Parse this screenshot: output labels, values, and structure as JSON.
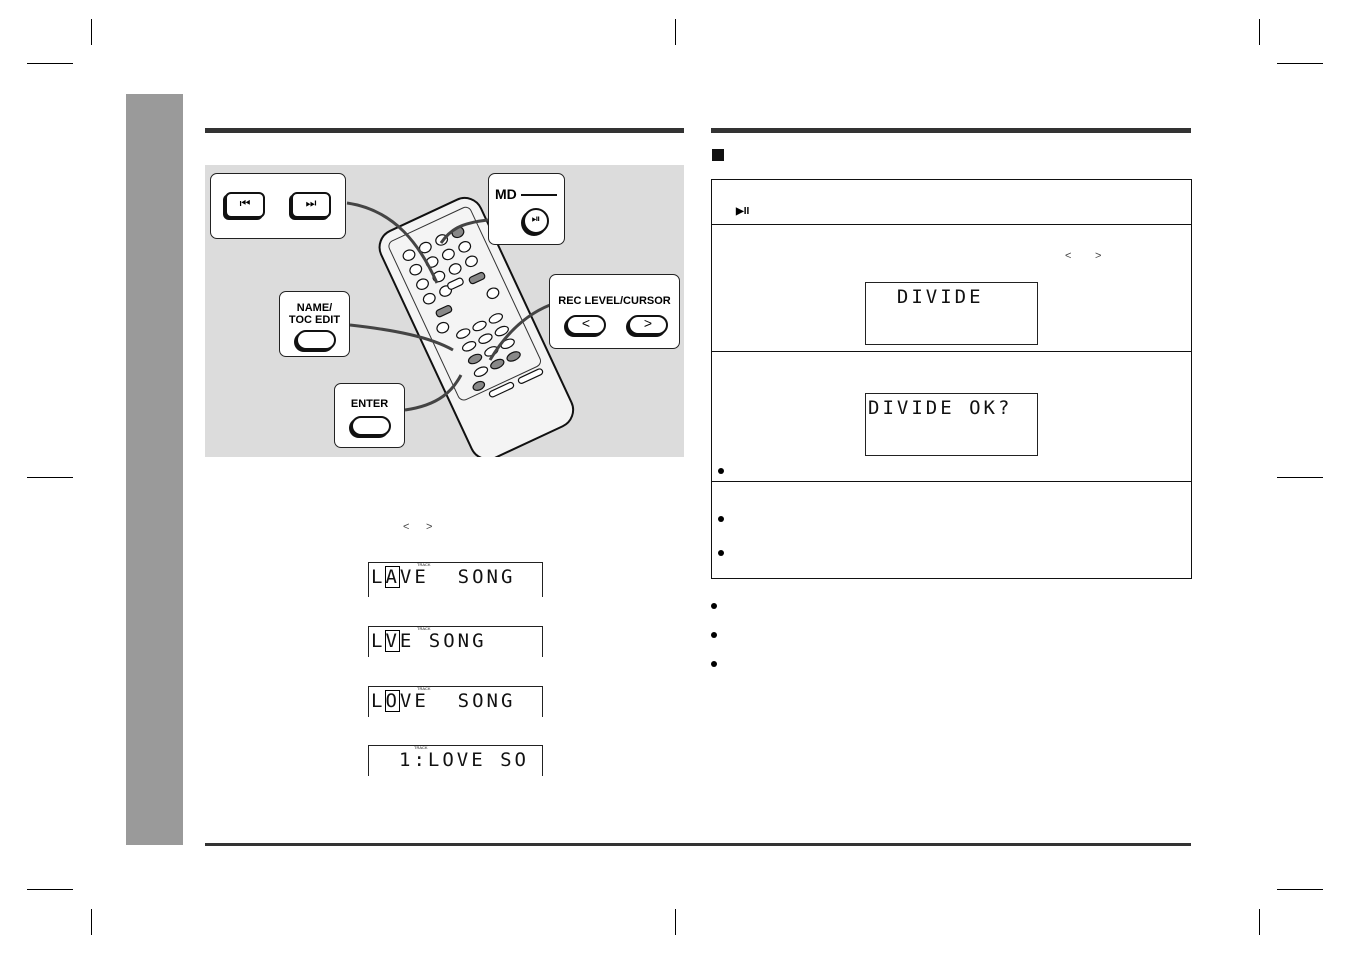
{
  "page": {
    "left_section": {
      "heading": "",
      "illustration": {
        "callouts": [
          {
            "id": "skip",
            "buttons": [
              "⏮",
              "⏭"
            ]
          },
          {
            "id": "md",
            "label": "MD",
            "button": "⏯"
          },
          {
            "id": "name-toc",
            "label": "NAME/\nTOC EDIT"
          },
          {
            "id": "rec-level",
            "label": "REC LEVEL/CURSOR",
            "buttons": [
              "<",
              ">"
            ]
          },
          {
            "id": "enter",
            "label": "ENTER"
          }
        ]
      },
      "cursor_glyphs": [
        "<",
        ">"
      ],
      "displays": [
        {
          "text": "LAVE SONG",
          "cursor_char": "A",
          "track": "TRACK"
        },
        {
          "text": "LVE SONG",
          "cursor_char": "V",
          "track": "TRACK"
        },
        {
          "text": "LOVE SONG",
          "cursor_char": "O",
          "track": "TRACK"
        },
        {
          "text": "1:LOVE SO",
          "track": "TRACK"
        }
      ]
    },
    "right_section": {
      "heading": "",
      "subheading_icon": "black-square",
      "steps": [
        {
          "glyph": "▶II"
        },
        {
          "glyphs": [
            "<",
            ">"
          ],
          "display": "  DIVIDE"
        },
        {
          "display": "DIVIDE OK?",
          "bullets": 1
        },
        {
          "bullets": 2
        }
      ],
      "notes_bullets": 3
    }
  }
}
